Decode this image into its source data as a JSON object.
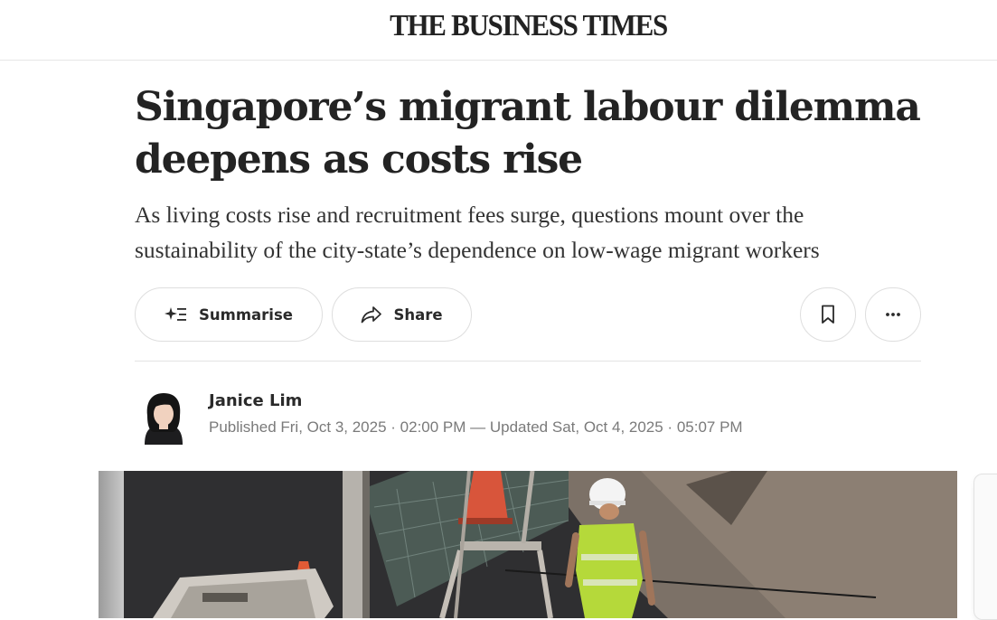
{
  "masthead": {
    "logo_text": "THE BUSINESS TIMES"
  },
  "article": {
    "headline": "Singapore’s migrant labour dilemma deepens as costs rise",
    "subheadline": "As living costs rise and recruitment fees surge, questions mount over the sustainability of the city-state’s dependence on low-wage migrant workers"
  },
  "actions": {
    "summarise_label": "Summarise",
    "share_label": "Share",
    "icons": {
      "summarise": "sparkle-list-icon",
      "share": "share-arrow-icon",
      "bookmark": "bookmark-icon",
      "more": "more-horizontal-icon"
    }
  },
  "byline": {
    "author_name": "Janice Lim",
    "dates": "Published Fri, Oct 3, 2025 · 02:00 PM — Updated Sat, Oct 4, 2025 · 05:07 PM"
  },
  "hero_image": {
    "subject": "construction-worker-photo"
  },
  "colors": {
    "text_primary": "#232323",
    "text_muted": "#7a7a7a",
    "border": "#dedede",
    "vest": "#b5d93a"
  }
}
